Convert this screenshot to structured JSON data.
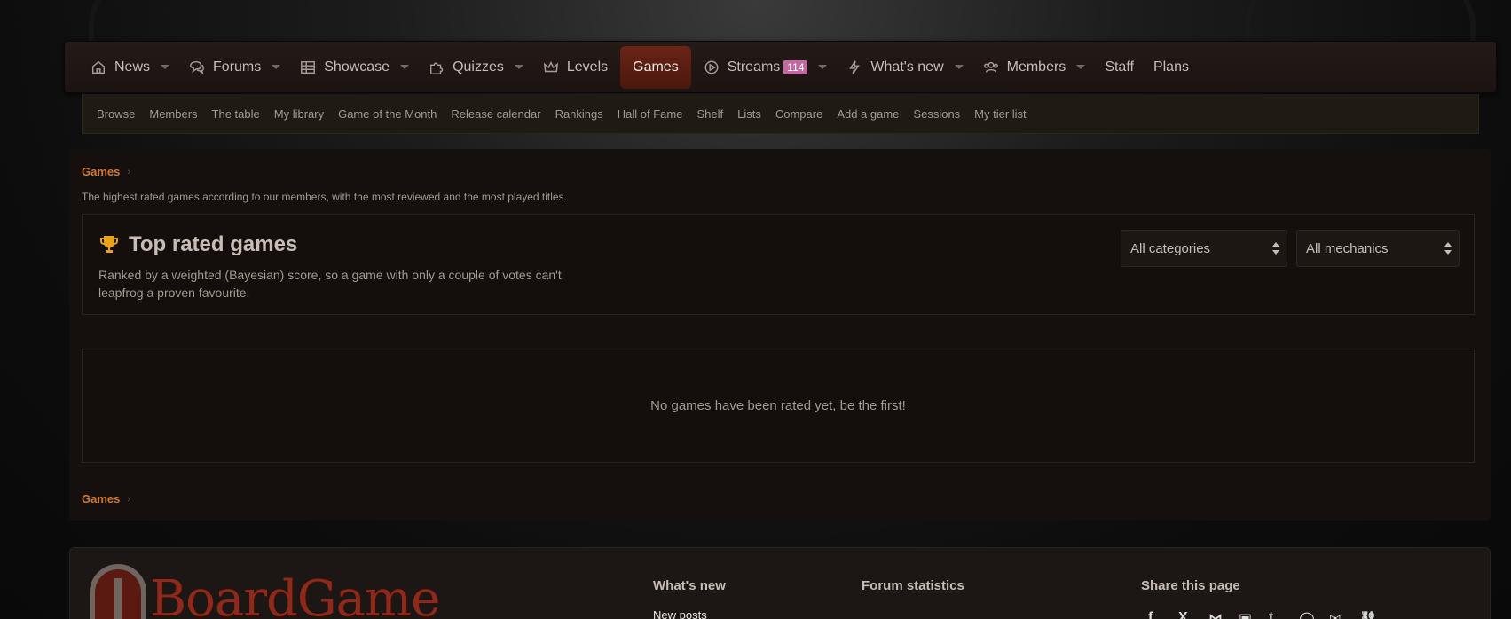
{
  "nav": {
    "items": [
      {
        "label": "News",
        "icon": "home-icon",
        "dropdown": true
      },
      {
        "label": "Forums",
        "icon": "comments-icon",
        "dropdown": true
      },
      {
        "label": "Showcase",
        "icon": "table-icon",
        "dropdown": true
      },
      {
        "label": "Quizzes",
        "icon": "puzzle-icon",
        "dropdown": true
      },
      {
        "label": "Levels",
        "icon": "crown-icon",
        "dropdown": false
      },
      {
        "label": "Games",
        "icon": "",
        "dropdown": false,
        "active": true
      },
      {
        "label": "Streams",
        "icon": "play-circle-icon",
        "dropdown": true,
        "badge": "114"
      },
      {
        "label": "What's new",
        "icon": "bolt-icon",
        "dropdown": true
      },
      {
        "label": "Members",
        "icon": "users-icon",
        "dropdown": true
      },
      {
        "label": "Staff",
        "icon": "",
        "dropdown": false
      },
      {
        "label": "Plans",
        "icon": "",
        "dropdown": false
      }
    ]
  },
  "subnav": {
    "items": [
      "Browse",
      "Members",
      "The table",
      "My library",
      "Game of the Month",
      "Release calendar",
      "Rankings",
      "Hall of Fame",
      "Shelf",
      "Lists",
      "Compare",
      "Add a game",
      "Sessions",
      "My tier list"
    ]
  },
  "breadcrumb": {
    "label": "Games"
  },
  "page": {
    "description": "The highest rated games according to our members, with the most reviewed and the most played titles.",
    "title": "Top rated games",
    "subtitle": "Ranked by a weighted (Bayesian) score, so a game with only a couple of votes can't leapfrog a proven favourite.",
    "filters": {
      "category": "All categories",
      "mechanics": "All mechanics"
    },
    "empty_message": "No games have been rated yet, be the first!"
  },
  "footer": {
    "logo_text": "BoardGame",
    "whats_new_heading": "What's new",
    "whats_new_link": "New posts",
    "stats_heading": "Forum statistics",
    "share_heading": "Share this page"
  },
  "colors": {
    "accent": "#d4782f",
    "active_tab": "#5c1e12",
    "badge": "#c06aa0",
    "trophy": "#e7a41b"
  }
}
